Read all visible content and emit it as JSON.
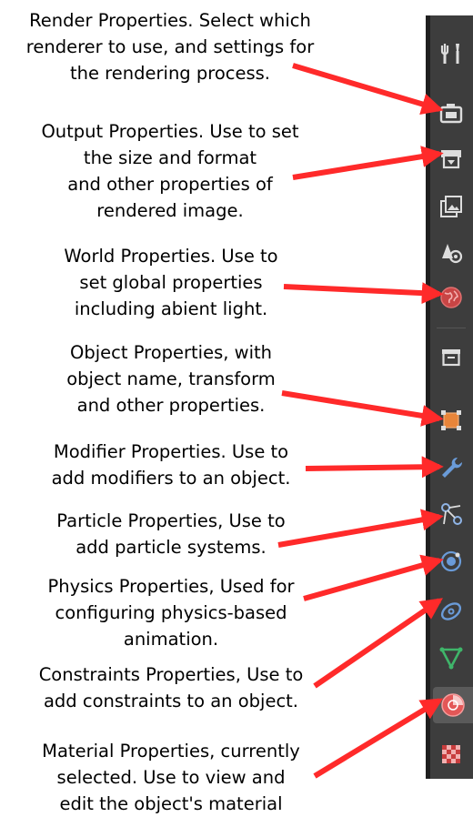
{
  "annotations": [
    {
      "id": "render",
      "text": "Render Properties.  Select which\nrenderer to use, and settings for\nthe rendering process."
    },
    {
      "id": "output",
      "text": "Output Properties.  Use to set\nthe size and format\nand other properties of\nrendered image."
    },
    {
      "id": "world",
      "text": "World Properties.  Use to\nset global properties\nincluding abient light."
    },
    {
      "id": "object",
      "text": "Object Properties, with\nobject name, transform\nand other properties."
    },
    {
      "id": "modifier",
      "text": "Modifier Properties.  Use to\nadd modifiers to an object."
    },
    {
      "id": "particle",
      "text": "Particle Properties, Use to\nadd particle systems."
    },
    {
      "id": "physics",
      "text": "Physics Properties, Used for\nconfiguring physics-based\nanimation."
    },
    {
      "id": "constraints",
      "text": "Constraints Properties, Use to\nadd constraints to an object."
    },
    {
      "id": "material",
      "text": "Material Properties, currently\nselected. Use to view and\nedit the object's material"
    }
  ],
  "toolbar": {
    "buttons": [
      {
        "name": "tool-properties-button",
        "icon": "tool-icon"
      },
      {
        "name": "render-properties-button",
        "icon": "camera-icon"
      },
      {
        "name": "output-properties-button",
        "icon": "printer-icon"
      },
      {
        "name": "view-layer-properties-button",
        "icon": "image-layers-icon"
      },
      {
        "name": "scene-properties-button",
        "icon": "scene-icon"
      },
      {
        "name": "world-properties-button",
        "icon": "world-icon"
      },
      {
        "name": "collection-properties-button",
        "icon": "collection-box-icon"
      },
      {
        "name": "object-properties-button",
        "icon": "object-square-icon"
      },
      {
        "name": "modifier-properties-button",
        "icon": "wrench-icon"
      },
      {
        "name": "particle-properties-button",
        "icon": "particles-icon"
      },
      {
        "name": "physics-properties-button",
        "icon": "physics-orbit-icon"
      },
      {
        "name": "constraint-properties-button",
        "icon": "constraint-icon"
      },
      {
        "name": "data-properties-button",
        "icon": "mesh-triangle-icon"
      },
      {
        "name": "material-properties-button",
        "icon": "material-sphere-icon",
        "selected": true
      },
      {
        "name": "texture-properties-button",
        "icon": "checker-texture-icon"
      }
    ]
  },
  "colors": {
    "arrow": "#ff2a2a",
    "panel": "#3d3d3d",
    "active": "#5a5a5a",
    "object_orange": "#e8853a",
    "modifier_blue": "#6a9bd8",
    "world_red": "#c84545",
    "data_green": "#3fb56a",
    "material_red": "#e35757"
  }
}
